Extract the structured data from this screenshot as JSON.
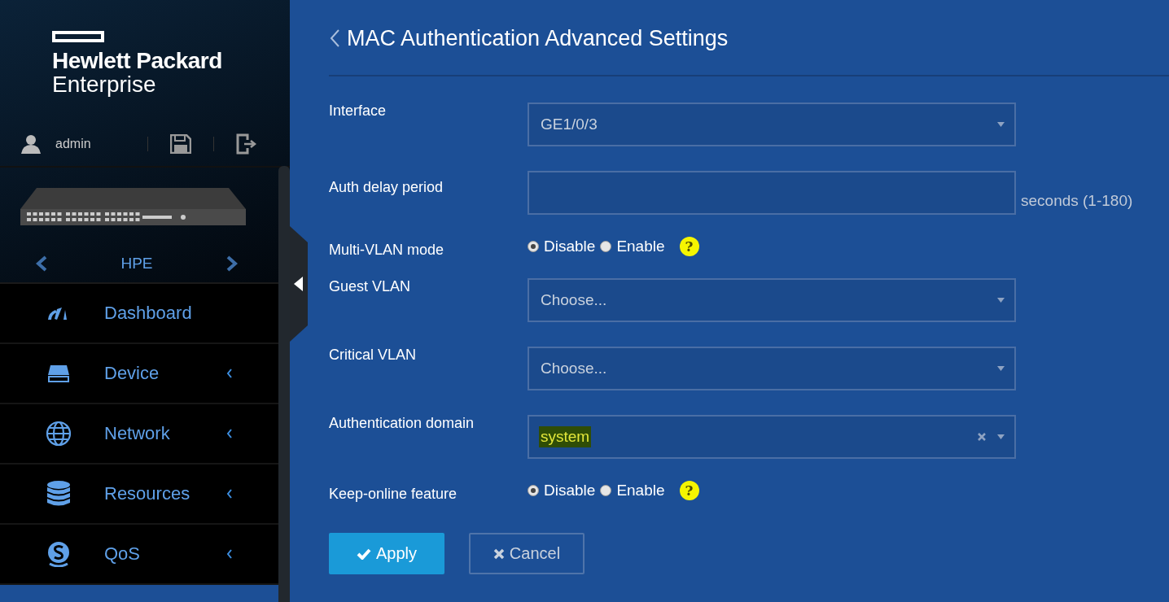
{
  "sidebar": {
    "logo": {
      "line_1": "Hewlett Packard",
      "line_2": "Enterprise"
    },
    "user": {
      "name": "admin"
    },
    "device": {
      "name": "HPE"
    },
    "menu": [
      {
        "label": "Dashboard",
        "kind": "gauge",
        "expandable": false
      },
      {
        "label": "Device",
        "kind": "drive",
        "expandable": true
      },
      {
        "label": "Network",
        "kind": "globe",
        "expandable": true
      },
      {
        "label": "Resources",
        "kind": "database",
        "expandable": true
      },
      {
        "label": "QoS",
        "kind": "qos",
        "expandable": true
      }
    ]
  },
  "page": {
    "title": "MAC Authentication Advanced Settings",
    "fields": [
      {
        "kind": "select",
        "label": "Interface",
        "value": "GE1/0/3"
      },
      {
        "kind": "input",
        "label": "Auth delay period",
        "suffix": "seconds (1-180)"
      },
      {
        "kind": "radio",
        "label": "Multi-VLAN mode",
        "help": "?",
        "options": [
          {
            "label": "Disable",
            "selected": true
          },
          {
            "label": "Enable",
            "selected": false
          }
        ]
      },
      {
        "kind": "select",
        "label": "Guest VLAN",
        "placeholder": "Choose..."
      },
      {
        "kind": "select",
        "label": "Critical VLAN",
        "placeholder": "Choose..."
      },
      {
        "kind": "select",
        "label": "Authentication domain",
        "value": "system",
        "highlighted": true,
        "clearable": true
      },
      {
        "kind": "radio",
        "label": "Keep-online feature",
        "help": "?",
        "options": [
          {
            "label": "Disable",
            "selected": true
          },
          {
            "label": "Enable",
            "selected": false
          }
        ]
      }
    ],
    "buttons": [
      {
        "kind": "primary",
        "label": "Apply"
      },
      {
        "kind": "secondary",
        "label": "Cancel"
      }
    ]
  }
}
